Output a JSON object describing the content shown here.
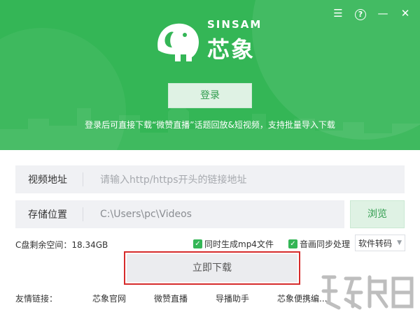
{
  "window_controls": {
    "menu_icon": "menu-icon",
    "help_label": "?",
    "minimize_label": "—",
    "close_label": "✕"
  },
  "brand": {
    "en": "SINSAM",
    "cn": "芯象"
  },
  "login_label": "登录",
  "notice": "登录后可直接下载“微赞直播”话题回放&短视频，支持批量导入下载",
  "video_url": {
    "label": "视频地址",
    "placeholder": "请输入http/https开头的链接地址"
  },
  "storage": {
    "label": "存储位置",
    "value": "C:\\Users\\pc\\Videos",
    "browse_label": "浏览"
  },
  "disk_space": "C盘剩余空间：18.34GB",
  "options": {
    "mp4_label": "同时生成mp4文件",
    "sync_label": "音画同步处理",
    "mp4_checked": true,
    "sync_checked": true
  },
  "transcode_select": "软件转码",
  "download_label": "立即下载",
  "friend_links": {
    "label": "友情链接：",
    "items": [
      "芯象官网",
      "微赞直播",
      "导播助手",
      "芯象便携编..."
    ]
  },
  "colors": {
    "brand_green": "#34b656",
    "highlight_red": "#d62b2b"
  }
}
